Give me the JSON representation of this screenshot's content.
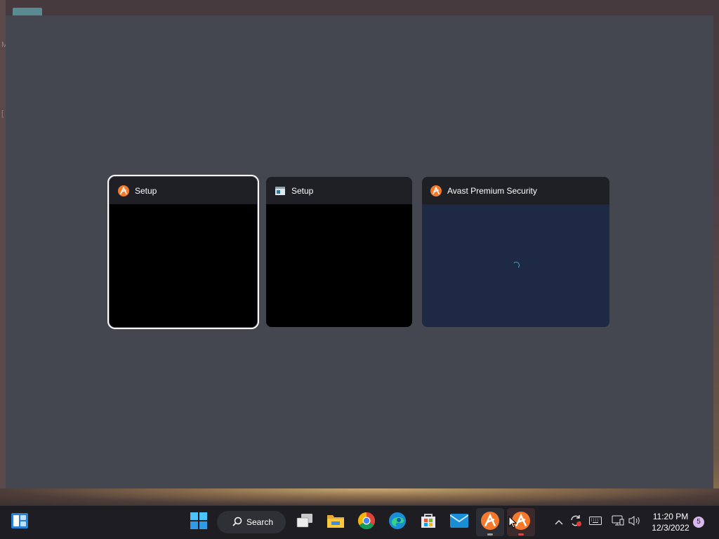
{
  "desktop": {
    "left_letters": [
      "M",
      "["
    ]
  },
  "task_switcher": {
    "windows": [
      {
        "title": "Setup",
        "icon": "avast-icon",
        "preview": "black",
        "selected": true
      },
      {
        "title": "Setup",
        "icon": "setup-window-icon",
        "preview": "black",
        "selected": false
      },
      {
        "title": "Avast Premium Security",
        "icon": "avast-icon",
        "preview": "navy-loading",
        "selected": false
      }
    ]
  },
  "taskbar": {
    "search_label": "Search",
    "pinned": [
      "widgets-icon",
      "start-icon",
      "search-icon",
      "task-view-icon",
      "file-explorer-icon",
      "chrome-icon",
      "edge-icon",
      "store-icon",
      "mail-icon",
      "avast-icon",
      "avast-icon"
    ],
    "tray": [
      "chevron-up-icon",
      "sync-icon",
      "keyboard-icon",
      "network-icon",
      "volume-icon"
    ],
    "clock": {
      "time": "11:20 PM",
      "date": "12/3/2022"
    },
    "notification_count": "5"
  },
  "colors": {
    "avast_orange": "#f5792a",
    "switcher_backdrop": "#444750",
    "taskbar": "#1d1d22",
    "preview_navy": "#1e2946"
  }
}
